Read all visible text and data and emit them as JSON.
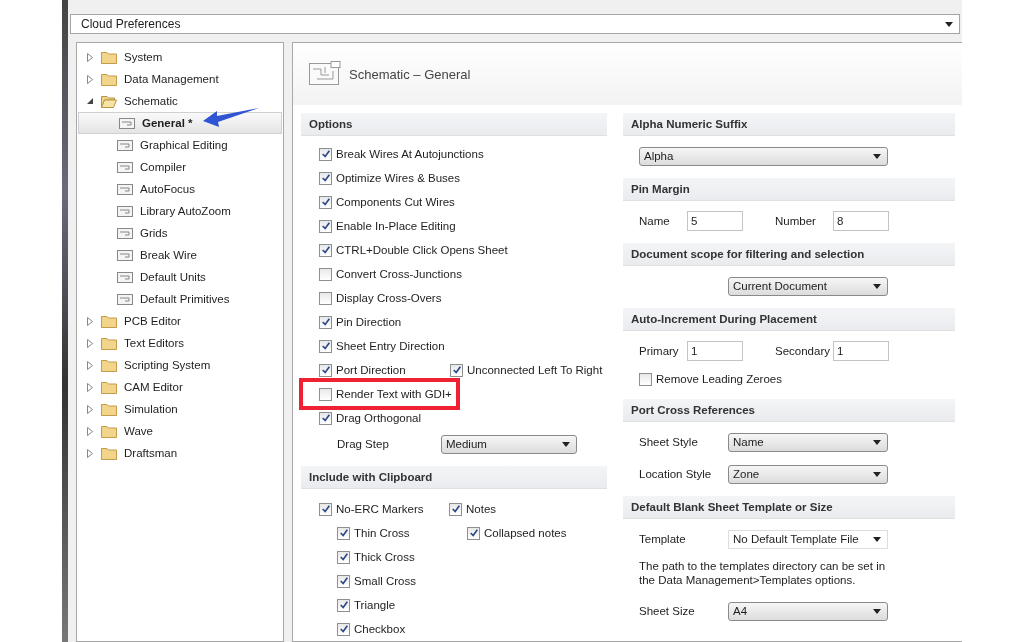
{
  "window": {
    "title": "Cloud Preferences"
  },
  "tree": [
    {
      "label": "System",
      "expanded": false,
      "selected": false
    },
    {
      "label": "Data Management",
      "expanded": false,
      "selected": false
    },
    {
      "label": "Schematic",
      "expanded": true,
      "selected": false,
      "children": [
        {
          "label": "General *",
          "selected": true,
          "pointer_arrow": true
        },
        {
          "label": "Graphical Editing",
          "selected": false
        },
        {
          "label": "Compiler",
          "selected": false
        },
        {
          "label": "AutoFocus",
          "selected": false
        },
        {
          "label": "Library AutoZoom",
          "selected": false
        },
        {
          "label": "Grids",
          "selected": false
        },
        {
          "label": "Break Wire",
          "selected": false
        },
        {
          "label": "Default Units",
          "selected": false
        },
        {
          "label": "Default Primitives",
          "selected": false
        }
      ]
    },
    {
      "label": "PCB Editor",
      "expanded": false,
      "selected": false
    },
    {
      "label": "Text Editors",
      "expanded": false,
      "selected": false
    },
    {
      "label": "Scripting System",
      "expanded": false,
      "selected": false
    },
    {
      "label": "CAM Editor",
      "expanded": false,
      "selected": false
    },
    {
      "label": "Simulation",
      "expanded": false,
      "selected": false
    },
    {
      "label": "Wave",
      "expanded": false,
      "selected": false
    },
    {
      "label": "Draftsman",
      "expanded": false,
      "selected": false
    }
  ],
  "page_title": "Schematic – General",
  "options": {
    "title": "Options",
    "items": [
      {
        "kind": "checkbox",
        "label": "Break Wires At Autojunctions",
        "checked": true
      },
      {
        "kind": "checkbox",
        "label": "Optimize Wires & Buses",
        "checked": true
      },
      {
        "kind": "checkbox",
        "label": "Components Cut Wires",
        "checked": true
      },
      {
        "kind": "checkbox",
        "label": "Enable In-Place Editing",
        "checked": true
      },
      {
        "kind": "checkbox",
        "label": "CTRL+Double Click Opens Sheet",
        "checked": true
      },
      {
        "kind": "checkbox",
        "label": "Convert Cross-Junctions",
        "checked": false
      },
      {
        "kind": "checkbox",
        "label": "Display Cross-Overs",
        "checked": false
      },
      {
        "kind": "checkbox",
        "label": "Pin Direction",
        "checked": true
      },
      {
        "kind": "checkbox",
        "label": "Sheet Entry Direction",
        "checked": true
      },
      {
        "kind": "checkbox",
        "label": "Port Direction",
        "checked": true,
        "extra": {
          "label": "Unconnected Left To Right",
          "checked": true
        }
      },
      {
        "kind": "checkbox",
        "label": "Render Text with GDI+",
        "checked": false,
        "highlighted": true
      },
      {
        "kind": "checkbox",
        "label": "Drag Orthogonal",
        "checked": true
      },
      {
        "kind": "select",
        "label": "Drag Step",
        "value": "Medium"
      }
    ]
  },
  "clipboard": {
    "title": "Include with Clipboard",
    "columns": [
      {
        "label": "No-ERC Markers",
        "checked": true,
        "children": [
          {
            "label": "Thin Cross",
            "checked": true
          },
          {
            "label": "Thick Cross",
            "checked": true
          },
          {
            "label": "Small Cross",
            "checked": true
          },
          {
            "label": "Triangle",
            "checked": true
          },
          {
            "label": "Checkbox",
            "checked": true
          }
        ]
      },
      {
        "label": "Notes",
        "checked": true,
        "children": [
          {
            "label": "Collapsed notes",
            "checked": true
          }
        ]
      }
    ]
  },
  "right_sections": [
    {
      "title": "Alpha Numeric Suffix",
      "items": [
        {
          "kind": "select-wide",
          "value": "Alpha"
        }
      ]
    },
    {
      "title": "Pin Margin",
      "items": [
        {
          "kind": "fields",
          "fields": [
            {
              "label": "Name",
              "value": "5"
            },
            {
              "label": "Number",
              "value": "8"
            }
          ]
        }
      ]
    },
    {
      "title": "Document scope for filtering and selection",
      "items": [
        {
          "kind": "select-indented",
          "value": "Current Document"
        }
      ]
    },
    {
      "title": "Auto-Increment During Placement",
      "items": [
        {
          "kind": "fields",
          "fields": [
            {
              "label": "Primary",
              "value": "1"
            },
            {
              "label": "Secondary",
              "value": "1"
            }
          ]
        },
        {
          "kind": "checkbox",
          "label": "Remove Leading Zeroes",
          "checked": false
        }
      ]
    },
    {
      "title": "Port Cross References",
      "items": [
        {
          "kind": "select",
          "label": "Sheet Style",
          "value": "Name"
        },
        {
          "kind": "select",
          "label": "Location Style",
          "value": "Zone"
        }
      ]
    },
    {
      "title": "Default Blank Sheet Template or Size",
      "items": [
        {
          "kind": "select",
          "label": "Template",
          "value": "No Default Template File",
          "flat": true
        },
        {
          "kind": "note",
          "text": "The path to the templates directory can be set in the Data Management>Templates options."
        },
        {
          "kind": "select",
          "label": "Sheet Size",
          "value": "A4"
        }
      ]
    }
  ]
}
